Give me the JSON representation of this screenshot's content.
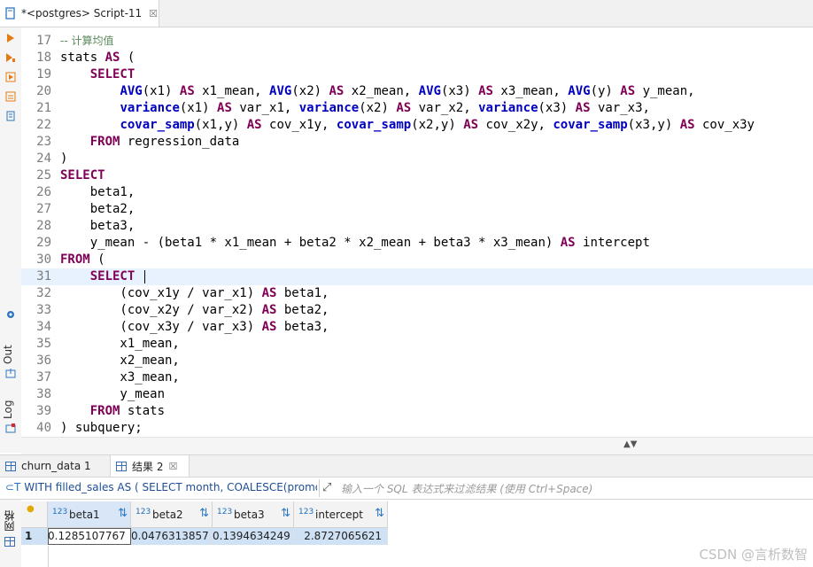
{
  "editor_tab": {
    "title": "*<postgres> Script-11",
    "close": "☒"
  },
  "side_panels": {
    "output": "Out",
    "log": "Log"
  },
  "code_lines": [
    {
      "n": "17",
      "tokens": [
        {
          "t": "-- 计算均值",
          "c": "cm"
        }
      ]
    },
    {
      "n": "18",
      "tokens": [
        {
          "t": "stats ",
          "c": ""
        },
        {
          "t": "AS",
          "c": "kw"
        },
        {
          "t": " (",
          "c": ""
        }
      ]
    },
    {
      "n": "19",
      "tokens": [
        {
          "t": "    ",
          "c": ""
        },
        {
          "t": "SELECT",
          "c": "kw"
        }
      ]
    },
    {
      "n": "20",
      "tokens": [
        {
          "t": "        ",
          "c": ""
        },
        {
          "t": "AVG",
          "c": "fn"
        },
        {
          "t": "(x1) ",
          "c": ""
        },
        {
          "t": "AS",
          "c": "kw"
        },
        {
          "t": " x1_mean, ",
          "c": ""
        },
        {
          "t": "AVG",
          "c": "fn"
        },
        {
          "t": "(x2) ",
          "c": ""
        },
        {
          "t": "AS",
          "c": "kw"
        },
        {
          "t": " x2_mean, ",
          "c": ""
        },
        {
          "t": "AVG",
          "c": "fn"
        },
        {
          "t": "(x3) ",
          "c": ""
        },
        {
          "t": "AS",
          "c": "kw"
        },
        {
          "t": " x3_mean, ",
          "c": ""
        },
        {
          "t": "AVG",
          "c": "fn"
        },
        {
          "t": "(y) ",
          "c": ""
        },
        {
          "t": "AS",
          "c": "kw"
        },
        {
          "t": " y_mean,",
          "c": ""
        }
      ]
    },
    {
      "n": "21",
      "tokens": [
        {
          "t": "        ",
          "c": ""
        },
        {
          "t": "variance",
          "c": "fn"
        },
        {
          "t": "(x1) ",
          "c": ""
        },
        {
          "t": "AS",
          "c": "kw"
        },
        {
          "t": " var_x1, ",
          "c": ""
        },
        {
          "t": "variance",
          "c": "fn"
        },
        {
          "t": "(x2) ",
          "c": ""
        },
        {
          "t": "AS",
          "c": "kw"
        },
        {
          "t": " var_x2, ",
          "c": ""
        },
        {
          "t": "variance",
          "c": "fn"
        },
        {
          "t": "(x3) ",
          "c": ""
        },
        {
          "t": "AS",
          "c": "kw"
        },
        {
          "t": " var_x3,",
          "c": ""
        }
      ]
    },
    {
      "n": "22",
      "tokens": [
        {
          "t": "        ",
          "c": ""
        },
        {
          "t": "covar_samp",
          "c": "fn"
        },
        {
          "t": "(x1,y) ",
          "c": ""
        },
        {
          "t": "AS",
          "c": "kw"
        },
        {
          "t": " cov_x1y, ",
          "c": ""
        },
        {
          "t": "covar_samp",
          "c": "fn"
        },
        {
          "t": "(x2,y) ",
          "c": ""
        },
        {
          "t": "AS",
          "c": "kw"
        },
        {
          "t": " cov_x2y, ",
          "c": ""
        },
        {
          "t": "covar_samp",
          "c": "fn"
        },
        {
          "t": "(x3,y) ",
          "c": ""
        },
        {
          "t": "AS",
          "c": "kw"
        },
        {
          "t": " cov_x3y",
          "c": ""
        }
      ]
    },
    {
      "n": "23",
      "tokens": [
        {
          "t": "    ",
          "c": ""
        },
        {
          "t": "FROM",
          "c": "kw"
        },
        {
          "t": " regression_data",
          "c": ""
        }
      ]
    },
    {
      "n": "24",
      "tokens": [
        {
          "t": ")",
          "c": ""
        }
      ]
    },
    {
      "n": "25",
      "tokens": [
        {
          "t": "SELECT",
          "c": "kw"
        }
      ]
    },
    {
      "n": "26",
      "tokens": [
        {
          "t": "    beta1,",
          "c": ""
        }
      ]
    },
    {
      "n": "27",
      "tokens": [
        {
          "t": "    beta2,",
          "c": ""
        }
      ]
    },
    {
      "n": "28",
      "tokens": [
        {
          "t": "    beta3,",
          "c": ""
        }
      ]
    },
    {
      "n": "29",
      "tokens": [
        {
          "t": "    y_mean - (beta1 * x1_mean + beta2 * x2_mean + beta3 * x3_mean) ",
          "c": ""
        },
        {
          "t": "AS",
          "c": "kw"
        },
        {
          "t": " intercept",
          "c": ""
        }
      ]
    },
    {
      "n": "30",
      "tokens": [
        {
          "t": "FROM",
          "c": "kw"
        },
        {
          "t": " (",
          "c": ""
        }
      ]
    },
    {
      "n": "31",
      "current": true,
      "tokens": [
        {
          "t": "    ",
          "c": ""
        },
        {
          "t": "SELECT",
          "c": "kw"
        },
        {
          "t": " ",
          "c": ""
        }
      ]
    },
    {
      "n": "32",
      "tokens": [
        {
          "t": "        (cov_x1y / var_x1) ",
          "c": ""
        },
        {
          "t": "AS",
          "c": "kw"
        },
        {
          "t": " beta1,",
          "c": ""
        }
      ]
    },
    {
      "n": "33",
      "tokens": [
        {
          "t": "        (cov_x2y / var_x2) ",
          "c": ""
        },
        {
          "t": "AS",
          "c": "kw"
        },
        {
          "t": " beta2,",
          "c": ""
        }
      ]
    },
    {
      "n": "34",
      "tokens": [
        {
          "t": "        (cov_x3y / var_x3) ",
          "c": ""
        },
        {
          "t": "AS",
          "c": "kw"
        },
        {
          "t": " beta3,",
          "c": ""
        }
      ]
    },
    {
      "n": "35",
      "tokens": [
        {
          "t": "        x1_mean,",
          "c": ""
        }
      ]
    },
    {
      "n": "36",
      "tokens": [
        {
          "t": "        x2_mean,",
          "c": ""
        }
      ]
    },
    {
      "n": "37",
      "tokens": [
        {
          "t": "        x3_mean,",
          "c": ""
        }
      ]
    },
    {
      "n": "38",
      "tokens": [
        {
          "t": "        y_mean",
          "c": ""
        }
      ]
    },
    {
      "n": "39",
      "tokens": [
        {
          "t": "    ",
          "c": ""
        },
        {
          "t": "FROM",
          "c": "kw"
        },
        {
          "t": " stats",
          "c": ""
        }
      ]
    },
    {
      "n": "40",
      "tokens": [
        {
          "t": ") subquery;",
          "c": ""
        }
      ]
    }
  ],
  "result_tabs": [
    {
      "label": "churn_data 1",
      "active": false
    },
    {
      "label": "结果 2",
      "active": true,
      "close": "☒"
    }
  ],
  "filter": {
    "query": "WITH filled_sales AS ( SELECT month, COALESCE(promo_",
    "placeholder": "输入一个 SQL 表达式来过滤结果 (使用 Ctrl+Space)"
  },
  "results_panel": {
    "grid_label": "网格"
  },
  "table": {
    "type_badge": "123",
    "columns": [
      "beta1",
      "beta2",
      "beta3",
      "intercept"
    ],
    "rows": [
      {
        "num": "1",
        "cells": [
          "0.1285107767",
          "0.0476313857",
          "0.1394634249",
          "2.8727065621"
        ]
      }
    ]
  },
  "watermark": "CSDN @言析数智",
  "colors": {
    "keyword": "#7f0055",
    "function": "#0000c0",
    "comment": "#5a8a5a",
    "current_line": "#e8f2fe",
    "selection": "#cfe1f5"
  }
}
